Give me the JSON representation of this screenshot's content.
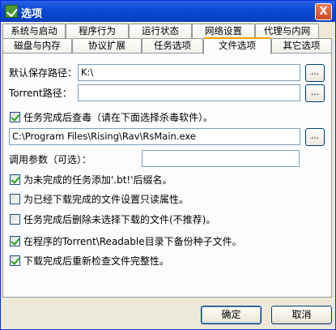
{
  "window": {
    "title": "选项",
    "close_glyph": "X"
  },
  "tabs_row1": [
    "系统与启动",
    "程序行为",
    "运行状态",
    "网络设置",
    "代理与内网"
  ],
  "tabs_row2": [
    "磁盘与内存",
    "协议扩展",
    "任务选项",
    "文件选项",
    "其它选项"
  ],
  "active_tab": "文件选项",
  "form": {
    "default_save_path": {
      "label": "默认保存路径：",
      "value": "K:\\"
    },
    "torrent_path": {
      "label": "Torrent路径：",
      "value": ""
    },
    "antivirus_check": {
      "label": "任务完成后查毒（请在下面选择杀毒软件）。",
      "checked": true
    },
    "antivirus_path": {
      "value": "C:\\Program Files\\Rising\\Rav\\RsMain.exe"
    },
    "call_params": {
      "label": "调用参数（可选）：",
      "value": ""
    },
    "browse_label": "...",
    "options": [
      {
        "label": "为未完成的任务添加'.bt!'后缀名。",
        "checked": true
      },
      {
        "label": "为已经下载完成的文件设置只读属性。",
        "checked": false
      },
      {
        "label": "任务完成后删除未选择下载的文件(不推荐)。",
        "checked": false
      },
      {
        "label": "在程序的Torrent\\Readable目录下备份种子文件。",
        "checked": true
      },
      {
        "label": "下载完成后重新检查文件完整性。",
        "checked": true
      }
    ]
  },
  "buttons": {
    "ok": "确定",
    "cancel": "取消"
  }
}
